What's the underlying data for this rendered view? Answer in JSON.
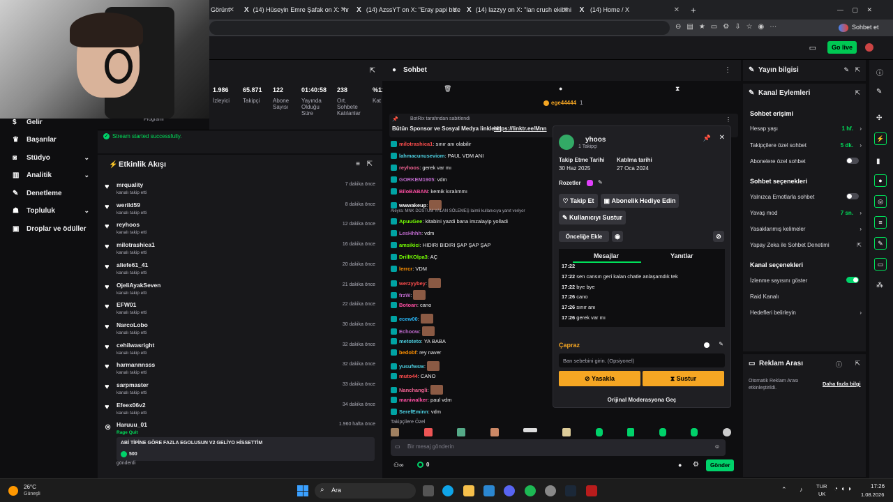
{
  "browser": {
    "tabs": [
      {
        "label": "Görünt",
        "has_logo": false
      },
      {
        "label": "(14) Hüseyin Emre Şafak on X: \"hm",
        "has_logo": true
      },
      {
        "label": "(14) AzssYT on X: \"Eray papi bize",
        "has_logo": true
      },
      {
        "label": "(14) lazzyy on X: \"lan crush ekibini",
        "has_logo": true
      },
      {
        "label": "(14) Home / X",
        "has_logo": true
      }
    ],
    "new_tab": "+",
    "profile_label": "Sohbet et"
  },
  "topnav": {
    "go_live": "Go live"
  },
  "leftnav": {
    "program_label": "Programı",
    "items": [
      {
        "label": "Gelir",
        "icon": "dollar-icon",
        "chev": false
      },
      {
        "label": "Başarılar",
        "icon": "trophy-icon",
        "chev": false
      },
      {
        "label": "Stüdyo",
        "icon": "camera-icon",
        "chev": true
      },
      {
        "label": "Analitik",
        "icon": "chart-icon",
        "chev": true
      },
      {
        "label": "Denetleme",
        "icon": "wrench-icon",
        "chev": false
      },
      {
        "label": "Topluluk",
        "icon": "people-icon",
        "chev": true
      },
      {
        "label": "Droplar ve ödüller",
        "icon": "gift-icon",
        "chev": false
      }
    ]
  },
  "stats": [
    {
      "value": "1.986",
      "label": "İzleyici"
    },
    {
      "value": "65.871",
      "label": "Takipçi"
    },
    {
      "value": "122",
      "label": "Abone Sayısı"
    },
    {
      "value": "01:40:58",
      "label": "Yayında Olduğu Süre"
    },
    {
      "value": "238",
      "label": "Ort. Sohbete Katılanlar"
    },
    {
      "value": "%11",
      "label": "Kat"
    }
  ],
  "stream_status": "Stream started successfully.",
  "feed": {
    "title": "Etkinlik Akışı",
    "follow_sub": "kanalı takip etti",
    "rows": [
      {
        "name": "mrquality",
        "time": "7 dakika önce"
      },
      {
        "name": "werild59",
        "time": "8 dakika önce"
      },
      {
        "name": "reyhoos",
        "time": "12 dakika önce"
      },
      {
        "name": "milotrashica1",
        "time": "16 dakika önce"
      },
      {
        "name": "aliefe61_41",
        "time": "20 dakika önce"
      },
      {
        "name": "OjeliAyakSeven",
        "time": "21 dakika önce"
      },
      {
        "name": "EFW01",
        "time": "22 dakika önce"
      },
      {
        "name": "NarcoLobo",
        "time": "30 dakika önce"
      },
      {
        "name": "cehilwasright",
        "time": "32 dakika önce"
      },
      {
        "name": "harmannnsss",
        "time": "32 dakika önce"
      },
      {
        "name": "sarpmaster",
        "time": "33 dakika önce"
      },
      {
        "name": "Efeex06v2",
        "time": "34 dakika önce"
      }
    ],
    "raid": {
      "name": "Haruuu_01",
      "time": "1.960 hafta önce",
      "type": "Rage Quit",
      "message": "ABİ TİPİNE GÖRE FAZLA EGOLUSUN V2 GELİYO HİSSETTİM",
      "amount": "500",
      "sent": "gönderdi"
    }
  },
  "chat": {
    "title": "Sohbet",
    "top_user": "ege44444",
    "top_count": "1",
    "pinned_by": "BotRix tarafından sabitlendi",
    "pinned_text": "Bütün Sponsor ve Sosyal Medya linkleri |",
    "pinned_link": "https://linktr.ee/Mnn",
    "reply_context": "Aleyra: MNK DOSTUM YALAN SÖLEMEŞ laimli kullanıcıya yanıt veriyor",
    "messages": [
      {
        "user": "milotrashica1",
        "color": "#ff4d4d",
        "text": ": sınır anı olabilir",
        "emote": false
      },
      {
        "user": "lahmacunuseviom",
        "color": "#4dd0e1",
        "text": ": PAUL VDM ANI",
        "emote": false
      },
      {
        "user": "reyhoos",
        "color": "#f06292",
        "text": ": gerek var mı",
        "emote": false
      },
      {
        "user": "GORKEM1905",
        "color": "#ba68c8",
        "text": ": vdm",
        "emote": false
      },
      {
        "user": "BiloBABAN",
        "color": "#ff4fa3",
        "text": ": kemik kıralımmı",
        "emote": false
      },
      {
        "user": "wwwakeup",
        "color": "#ffffff",
        "text": ":",
        "emote": true
      },
      {
        "user": "ApuuGee",
        "color": "#76ff03",
        "text": ": kitabini yazdi bana imzalayip yolladi",
        "emote": false
      },
      {
        "user": "LesHhhh",
        "color": "#ba68c8",
        "text": ": vdm",
        "emote": false
      },
      {
        "user": "amsikici",
        "color": "#76ff03",
        "text": ": HIDIRI BIDIRI ŞAP ŞAP ŞAP",
        "emote": false
      },
      {
        "user": "DrillKOlpa3",
        "color": "#76ff03",
        "text": ": AÇ",
        "emote": false
      },
      {
        "user": "lerrcr",
        "color": "#ff9100",
        "text": ": VDM",
        "emote": false
      },
      {
        "user": "werzyybey",
        "color": "#ff4d4d",
        "text": ":",
        "emote": true
      },
      {
        "user": "frzW",
        "color": "#ba68c8",
        "text": ":",
        "emote": true
      },
      {
        "user": "Botoan",
        "color": "#ff4fa3",
        "text": ": cano",
        "emote": false
      },
      {
        "user": "ecew00",
        "color": "#29b6f6",
        "text": ":",
        "emote": true
      },
      {
        "user": "Echoow",
        "color": "#ba68c8",
        "text": ":",
        "emote": true
      },
      {
        "user": "metoteto",
        "color": "#4dd0e1",
        "text": ": YA BABA",
        "emote": false
      },
      {
        "user": "bedobf",
        "color": "#ff9100",
        "text": ": rey naver",
        "emote": false
      },
      {
        "user": "yusufwsw",
        "color": "#4dd0e1",
        "text": ":",
        "emote": true
      },
      {
        "user": "muto44",
        "color": "#ff4d4d",
        "text": ": CANO",
        "emote": false
      },
      {
        "user": "Nanchangli",
        "color": "#f06292",
        "text": ":",
        "emote": true
      },
      {
        "user": "maniwalker",
        "color": "#ff4fa3",
        "text": ": paul vdm",
        "emote": false
      },
      {
        "user": "SerefEminn",
        "color": "#4dd0e1",
        "text": ": vdm",
        "emote": false
      }
    ],
    "followers_only": "Takipçilere Özel",
    "input_placeholder": "Bir mesaj gönderin",
    "points": "0",
    "send": "Gönder"
  },
  "card": {
    "username": "yhoos",
    "followers": "1 Takipçi",
    "follow_date_label": "Takip Etme Tarihi",
    "follow_date": "30 Haz 2025",
    "join_date_label": "Katılma tarihi",
    "join_date": "27 Oca 2024",
    "badges": "Rozetler",
    "follow_btn": "Takip Et",
    "gift_btn": "Abonelik Hediye Edin",
    "mute_btn": "Kullanıcıyı Sustur",
    "prio_btn": "Önceliğe Ekle",
    "tab_messages": "Mesajlar",
    "tab_replies": "Yanıtlar",
    "history": [
      {
        "time": "17:22",
        "text": ""
      },
      {
        "time": "17:22",
        "text": "sen cansın geri kalan chatle anlaşamdık tek"
      },
      {
        "time": "17:22",
        "text": "bye bye"
      },
      {
        "time": "17:26",
        "text": "cano"
      },
      {
        "time": "17:26",
        "text": "sınır anı"
      },
      {
        "time": "17:26",
        "text": "gerek var mı"
      }
    ],
    "cross_label": "Çapraz",
    "reason_placeholder": "Ban sebebini girin. (Opsiyonel)",
    "ban_btn": "Yasakla",
    "mute2_btn": "Sustur",
    "original_mod": "Orijinal Moderasyona Geç"
  },
  "right": {
    "stream_info": "Yayın bilgisi",
    "channel_actions": "Kanal Eylemleri",
    "chat_access": "Sohbet erişimi",
    "account_age": {
      "label": "Hesap yaşı",
      "value": "1 hf."
    },
    "followers_only": {
      "label": "Takipçilere özel sohbet",
      "value": "5 dk."
    },
    "subs_only": "Abonelere özel sohbet",
    "chat_options": "Sohbet seçenekleri",
    "emote_only": "Yalnızca Emotlarla sohbet",
    "slow_mode": {
      "label": "Yavaş mod",
      "value": "7 sn."
    },
    "banned_words": "Yasaklanmış kelimeler",
    "ai_mod": "Yapay Zeka ile Sohbet Denetimi",
    "channel_options": "Kanal seçenekleri",
    "show_viewers": "İzlenme sayısını göster",
    "raid_channel": "Raid Kanalı",
    "set_goals": "Hedefleri belirleyin",
    "ad_break": "Reklam Arası",
    "ad_auto": "Otomatik Reklam Arası etkinleştirildi.",
    "more_info": "Daha fazla bilgi",
    "colors": {
      "accent": "#00e05a",
      "panel": "#18181b"
    }
  },
  "taskbar": {
    "weather_temp": "26°C",
    "weather_desc": "Güneşli",
    "search": "Ara",
    "lang": "TUR",
    "lang2": "UK",
    "time": "17:26",
    "date": "1.08.2026"
  }
}
